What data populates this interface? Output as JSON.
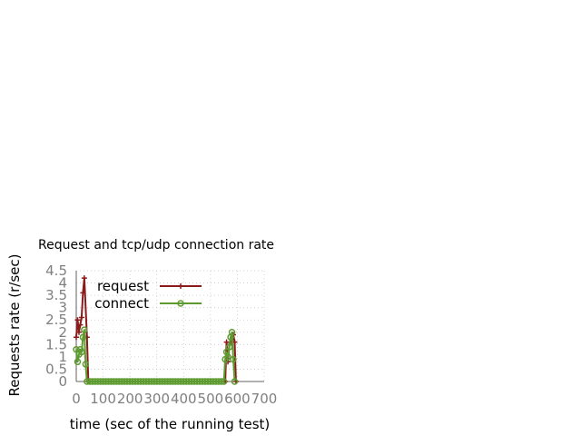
{
  "chart_data": {
    "type": "line",
    "title": "Request and tcp/udp connection rate",
    "xlabel": "time (sec of the running test)",
    "ylabel": "Requests rate (r/sec)",
    "xlim": [
      0,
      700
    ],
    "ylim": [
      0,
      4.5
    ],
    "x_ticks": [
      "0",
      "100",
      "200",
      "300",
      "400",
      "500",
      "600",
      "700"
    ],
    "y_ticks": [
      "0",
      "0.5",
      "1",
      "1.5",
      "2",
      "2.5",
      "3",
      "3.5",
      "4",
      "4.5"
    ],
    "grid": true,
    "legend_position": "top-left",
    "series": [
      {
        "name": "request",
        "color": "#8b1a1a",
        "marker": "plus",
        "points": [
          [
            0,
            1.8
          ],
          [
            5,
            2.5
          ],
          [
            10,
            2.0
          ],
          [
            15,
            2.3
          ],
          [
            20,
            2.6
          ],
          [
            25,
            3.6
          ],
          [
            30,
            4.2
          ],
          [
            40,
            1.8
          ],
          [
            45,
            0.0
          ],
          [
            100,
            0.0
          ],
          [
            200,
            0.0
          ],
          [
            300,
            0.0
          ],
          [
            400,
            0.0
          ],
          [
            500,
            0.0
          ],
          [
            555,
            0.0
          ],
          [
            560,
            1.6
          ],
          [
            565,
            0.8
          ],
          [
            570,
            1.5
          ],
          [
            575,
            1.6
          ],
          [
            580,
            1.7
          ],
          [
            585,
            1.9
          ],
          [
            590,
            1.6
          ],
          [
            595,
            0.0
          ]
        ]
      },
      {
        "name": "connect",
        "color": "#5d9b30",
        "marker": "circle",
        "points": [
          [
            0,
            1.3
          ],
          [
            5,
            0.8
          ],
          [
            10,
            1.1
          ],
          [
            15,
            1.3
          ],
          [
            20,
            1.2
          ],
          [
            25,
            1.8
          ],
          [
            30,
            2.1
          ],
          [
            35,
            0.7
          ],
          [
            40,
            0.0
          ],
          [
            50,
            0.0
          ],
          [
            60,
            0.0
          ],
          [
            70,
            0.0
          ],
          [
            80,
            0.0
          ],
          [
            90,
            0.0
          ],
          [
            100,
            0.0
          ],
          [
            110,
            0.0
          ],
          [
            120,
            0.0
          ],
          [
            130,
            0.0
          ],
          [
            140,
            0.0
          ],
          [
            150,
            0.0
          ],
          [
            160,
            0.0
          ],
          [
            170,
            0.0
          ],
          [
            180,
            0.0
          ],
          [
            190,
            0.0
          ],
          [
            200,
            0.0
          ],
          [
            210,
            0.0
          ],
          [
            220,
            0.0
          ],
          [
            230,
            0.0
          ],
          [
            240,
            0.0
          ],
          [
            250,
            0.0
          ],
          [
            260,
            0.0
          ],
          [
            270,
            0.0
          ],
          [
            280,
            0.0
          ],
          [
            290,
            0.0
          ],
          [
            300,
            0.0
          ],
          [
            310,
            0.0
          ],
          [
            320,
            0.0
          ],
          [
            330,
            0.0
          ],
          [
            340,
            0.0
          ],
          [
            350,
            0.0
          ],
          [
            360,
            0.0
          ],
          [
            370,
            0.0
          ],
          [
            380,
            0.0
          ],
          [
            390,
            0.0
          ],
          [
            400,
            0.0
          ],
          [
            410,
            0.0
          ],
          [
            420,
            0.0
          ],
          [
            430,
            0.0
          ],
          [
            440,
            0.0
          ],
          [
            450,
            0.0
          ],
          [
            460,
            0.0
          ],
          [
            470,
            0.0
          ],
          [
            480,
            0.0
          ],
          [
            490,
            0.0
          ],
          [
            500,
            0.0
          ],
          [
            510,
            0.0
          ],
          [
            520,
            0.0
          ],
          [
            530,
            0.0
          ],
          [
            540,
            0.0
          ],
          [
            550,
            0.0
          ],
          [
            555,
            0.9
          ],
          [
            560,
            1.2
          ],
          [
            565,
            1.0
          ],
          [
            570,
            1.4
          ],
          [
            575,
            1.8
          ],
          [
            580,
            2.0
          ],
          [
            585,
            0.9
          ],
          [
            590,
            0.0
          ]
        ]
      }
    ]
  }
}
